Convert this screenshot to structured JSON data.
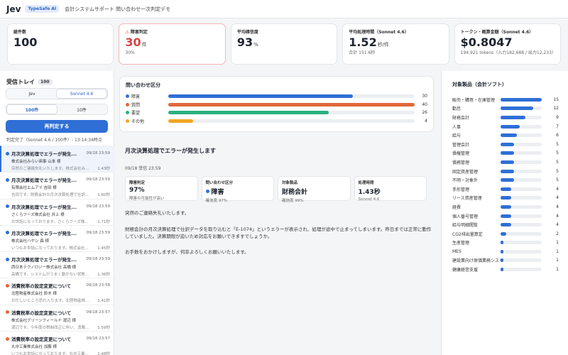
{
  "header": {
    "logo": "Jev",
    "badge": "TypeSafe AI",
    "subtitle": "会計システムサポート 問い合わせ一次判定デモ"
  },
  "colors": {
    "primary": "#2f6fd6",
    "alert": "#d64545",
    "category_fault": "#2f6fd6",
    "category_question": "#e0683a",
    "category_request": "#2bb07f",
    "category_other": "#f0a524"
  },
  "cards": [
    {
      "label": "総件数",
      "value": "100",
      "unit": "",
      "sub": ""
    },
    {
      "warn_icon": "⚠",
      "label": "障害判定",
      "value": "30",
      "unit": "件",
      "sub": "30%"
    },
    {
      "label": "平均確信度",
      "value": "93",
      "unit": "%",
      "sub": ""
    },
    {
      "label": "平均処理時間（Sonnet 4.6）",
      "value": "1.52",
      "unit": "秒/件",
      "sub": "合計 151.6秒"
    },
    {
      "label": "トークン・概算金額（Sonnet 4.6）",
      "value": "$0.8047",
      "unit": "",
      "sub": "194,921 tokens（入力182,688 / 出力12,233）"
    }
  ],
  "inbox": {
    "title": "受信トレイ",
    "count": "100",
    "models": [
      "Jev",
      "Sonnet 4.6"
    ],
    "limits": [
      "100件",
      "10件"
    ],
    "rejudge_label": "再判定する",
    "status": "判定完了（Sonnet 4.6 / 100件）- 13:14:34時点",
    "messages": [
      {
        "subject": "月次決算処理でエラーが発生...",
        "date": "09/18 23:59",
        "company": "株式会社みらい商事 山本 様",
        "preview": "突然のご連絡失礼いたします。株式会社み...",
        "time": "1.43秒",
        "color": "#2f6fd6"
      },
      {
        "subject": "月次決算処理でエラーが発生...",
        "date": "09/18 23:59",
        "company": "有限会社エムアイ 吉田 様",
        "preview": "吉田です。財務会計の月次決算処理で仕訳...",
        "time": "1.60秒",
        "color": "#2f6fd6"
      },
      {
        "subject": "月次決算処理でエラーが発生...",
        "date": "09/18 23:59",
        "company": "さくらフーズ株式会社 井上 様",
        "preview": "お世話になっております。さくらフーズ株...",
        "time": "1.71秒",
        "color": "#2f6fd6"
      },
      {
        "subject": "月次決算処理でエラーが発生...",
        "date": "09/18 23:59",
        "company": "株式会社ハヤシ 森 様",
        "preview": "いつもお世話になっております。株式会社...",
        "time": "1.45秒",
        "color": "#2f6fd6"
      },
      {
        "subject": "月次決算処理でエラーが発生...",
        "date": "09/18 23:59",
        "company": "西日本テクノロジー株式会社 高橋 様",
        "preview": "高橋です。システムがうまく動かない状態...",
        "time": "1.36秒",
        "color": "#2f6fd6"
      },
      {
        "subject": "消費税率の設定変更について",
        "date": "09/18 23:58",
        "company": "北陸物産株式会社 鈴木 様",
        "preview": "お忙しいところ恐れ入ります。北陸物産株...",
        "time": "1.41秒",
        "color": "#e0683a"
      },
      {
        "subject": "消費税率の設定変更について",
        "date": "09/18 23:57",
        "company": "株式会社グリーンフィールド 渡辺 様",
        "preview": "渡辺です。今年度の税制改正に伴い、消費...",
        "time": "1.59秒",
        "color": "#e0683a"
      },
      {
        "subject": "消費税率の設定変更について",
        "date": "09/18 23:57",
        "company": "丸中工業株式会社 加藤 様",
        "preview": "いつもお世話になっております。丸中工業...",
        "time": "1.48秒",
        "color": "#e0683a"
      }
    ]
  },
  "categories": {
    "title": "問い合わせ区分",
    "max": 40,
    "items": [
      {
        "label": "障害",
        "count": 30,
        "color": "#2f6fd6"
      },
      {
        "label": "質問",
        "count": 40,
        "color": "#e0683a"
      },
      {
        "label": "要望",
        "count": 26,
        "color": "#2bb07f"
      },
      {
        "label": "その他",
        "count": 4,
        "color": "#f0a524"
      }
    ]
  },
  "detail": {
    "title": "月次決算処理でエラーが発生します",
    "date": "09/18 受信 23:59",
    "boxes": [
      {
        "label": "障害判定",
        "value": "97%",
        "sub": "障害の可能性が高い"
      },
      {
        "label": "問い合わせ区分",
        "value": "障害",
        "sub": "確信度 97%",
        "dot": "#2f6fd6"
      },
      {
        "label": "対象製品",
        "value": "財務会計",
        "sub": "確信度 99%"
      },
      {
        "label": "処理時間",
        "value": "1.43秒",
        "sub": "Sonnet 4.6"
      }
    ],
    "paragraphs": [
      "突然のご連絡失礼いたします。",
      "財務会計の月次決算処理で仕訳データを取り込むと「E-1074」というエラーが表示され、処理が途中で止まってしまいます。昨日までは正常に動作していました。決算期限が迫いため対応をお願いできますでしょうか。",
      "お手数をおかけしますが、何卒よろしくお願いいたします。"
    ]
  },
  "products": {
    "title": "対象製品（会計ソフト）",
    "max": 15,
    "items": [
      {
        "label": "販売・購買・在庫管理",
        "count": 15
      },
      {
        "label": "勤怠",
        "count": 12
      },
      {
        "label": "財務会計",
        "count": 9
      },
      {
        "label": "人事",
        "count": 7
      },
      {
        "label": "給与",
        "count": 6
      },
      {
        "label": "管理会計",
        "count": 5
      },
      {
        "label": "債権管理",
        "count": 5
      },
      {
        "label": "債務管理",
        "count": 5
      },
      {
        "label": "固定資産管理",
        "count": 5
      },
      {
        "label": "不明・対象外",
        "count": 5
      },
      {
        "label": "手形管理",
        "count": 4
      },
      {
        "label": "リース資産管理",
        "count": 4
      },
      {
        "label": "経費",
        "count": 4
      },
      {
        "label": "個人番号管理",
        "count": 4
      },
      {
        "label": "給与明細閲覧",
        "count": 4
      },
      {
        "label": "CO2排出量算定",
        "count": 2
      },
      {
        "label": "生産管理",
        "count": 1
      },
      {
        "label": "MES",
        "count": 1
      },
      {
        "label": "建設業向け原価業務システム",
        "count": 1
      },
      {
        "label": "健康経営支援",
        "count": 1
      }
    ]
  }
}
